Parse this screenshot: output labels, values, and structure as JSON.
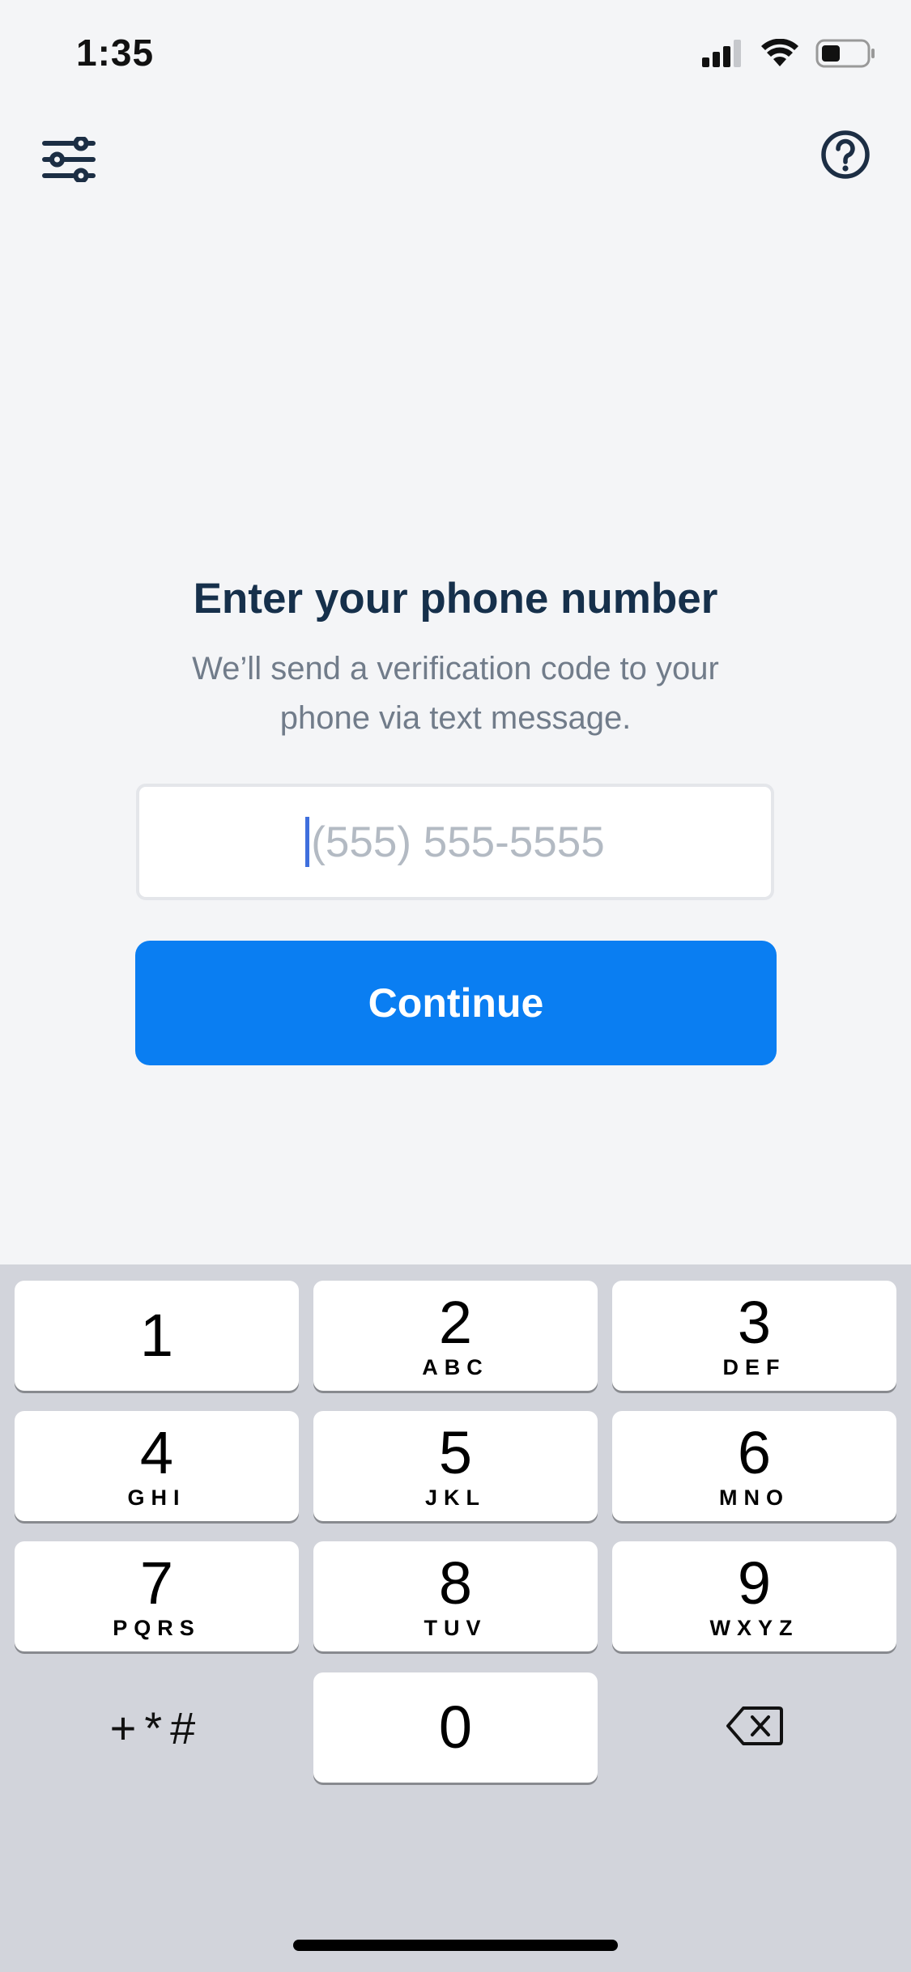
{
  "status_bar": {
    "time": "1:35",
    "icons": [
      "cellular-signal-icon",
      "wifi-icon",
      "battery-icon"
    ]
  },
  "top_bar": {
    "left_icon": "filter-sliders-icon",
    "right_icon": "help-question-icon"
  },
  "main": {
    "title": "Enter your phone number",
    "subtitle": "We’ll send a verification code to your phone via text message.",
    "phone_input": {
      "value": "",
      "placeholder": "(555) 555-5555"
    },
    "continue_label": "Continue",
    "accent_color": "#0a7ef2"
  },
  "keypad": {
    "keys": [
      {
        "digit": "1",
        "letters": ""
      },
      {
        "digit": "2",
        "letters": "ABC"
      },
      {
        "digit": "3",
        "letters": "DEF"
      },
      {
        "digit": "4",
        "letters": "GHI"
      },
      {
        "digit": "5",
        "letters": "JKL"
      },
      {
        "digit": "6",
        "letters": "MNO"
      },
      {
        "digit": "7",
        "letters": "PQRS"
      },
      {
        "digit": "8",
        "letters": "TUV"
      },
      {
        "digit": "9",
        "letters": "WXYZ"
      },
      {
        "digit": "0",
        "letters": ""
      }
    ],
    "symbols_label": "+*#",
    "delete_icon": "backspace-icon"
  }
}
